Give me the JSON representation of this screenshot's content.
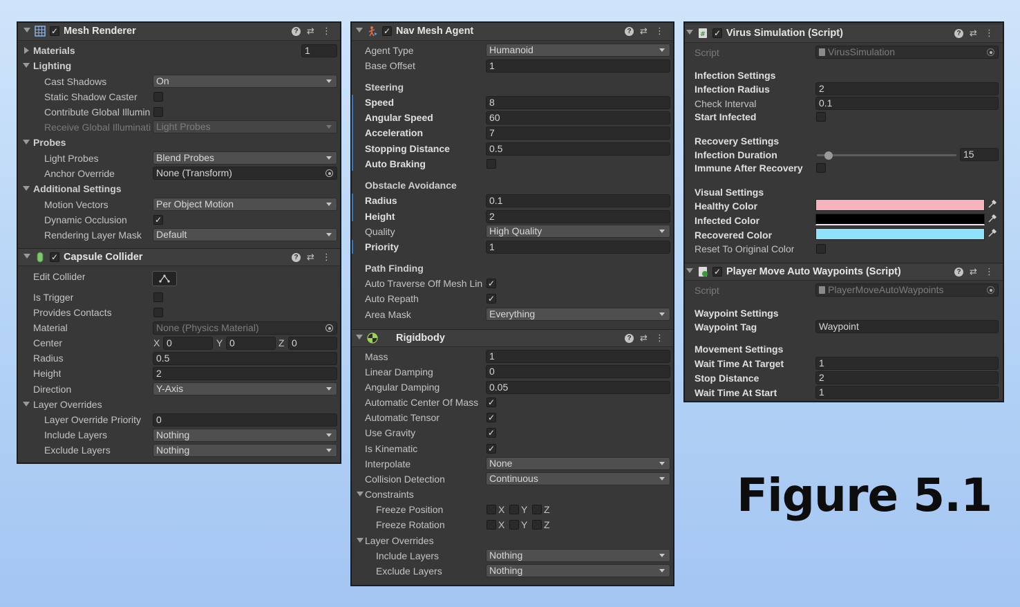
{
  "figure_label": "Figure 5.1",
  "mesh_renderer": {
    "title": "Mesh Renderer",
    "materials_label": "Materials",
    "materials_count": "1",
    "lighting_label": "Lighting",
    "cast_shadows_label": "Cast Shadows",
    "cast_shadows_value": "On",
    "static_shadow_caster_label": "Static Shadow Caster",
    "contribute_gi_label": "Contribute Global Illumin",
    "receive_gi_label": "Receive Global Illuminati",
    "receive_gi_value": "Light Probes",
    "probes_label": "Probes",
    "light_probes_label": "Light Probes",
    "light_probes_value": "Blend Probes",
    "anchor_override_label": "Anchor Override",
    "anchor_override_value": "None (Transform)",
    "additional_label": "Additional Settings",
    "motion_vectors_label": "Motion Vectors",
    "motion_vectors_value": "Per Object Motion",
    "dynamic_occlusion_label": "Dynamic Occlusion",
    "rendering_layer_label": "Rendering Layer Mask",
    "rendering_layer_value": "Default"
  },
  "capsule_collider": {
    "title": "Capsule Collider",
    "edit_collider_label": "Edit Collider",
    "is_trigger_label": "Is Trigger",
    "provides_contacts_label": "Provides Contacts",
    "material_label": "Material",
    "material_value": "None (Physics Material)",
    "center_label": "Center",
    "x_label": "X",
    "y_label": "Y",
    "z_label": "Z",
    "center_x": "0",
    "center_y": "0",
    "center_z": "0",
    "radius_label": "Radius",
    "radius_value": "0.5",
    "height_label": "Height",
    "height_value": "2",
    "direction_label": "Direction",
    "direction_value": "Y-Axis",
    "layer_overrides_label": "Layer Overrides",
    "layer_priority_label": "Layer Override Priority",
    "layer_priority_value": "0",
    "include_layers_label": "Include Layers",
    "include_layers_value": "Nothing",
    "exclude_layers_label": "Exclude Layers",
    "exclude_layers_value": "Nothing"
  },
  "nav_mesh_agent": {
    "title": "Nav Mesh Agent",
    "agent_type_label": "Agent Type",
    "agent_type_value": "Humanoid",
    "base_offset_label": "Base Offset",
    "base_offset_value": "1",
    "steering_label": "Steering",
    "speed_label": "Speed",
    "speed_value": "8",
    "angular_speed_label": "Angular Speed",
    "angular_speed_value": "60",
    "acceleration_label": "Acceleration",
    "acceleration_value": "7",
    "stopping_distance_label": "Stopping Distance",
    "stopping_distance_value": "0.5",
    "auto_braking_label": "Auto Braking",
    "obstacle_label": "Obstacle Avoidance",
    "radius_label": "Radius",
    "radius_value": "0.1",
    "height_label": "Height",
    "height_value": "2",
    "quality_label": "Quality",
    "quality_value": "High Quality",
    "priority_label": "Priority",
    "priority_value": "1",
    "path_label": "Path Finding",
    "auto_traverse_label": "Auto Traverse Off Mesh Lin",
    "auto_repath_label": "Auto Repath",
    "area_mask_label": "Area Mask",
    "area_mask_value": "Everything"
  },
  "rigidbody": {
    "title": "Rigidbody",
    "mass_label": "Mass",
    "mass_value": "1",
    "linear_damping_label": "Linear Damping",
    "linear_damping_value": "0",
    "angular_damping_label": "Angular Damping",
    "angular_damping_value": "0.05",
    "auto_center_label": "Automatic Center Of Mass",
    "auto_tensor_label": "Automatic Tensor",
    "use_gravity_label": "Use Gravity",
    "is_kinematic_label": "Is Kinematic",
    "interpolate_label": "Interpolate",
    "interpolate_value": "None",
    "collision_label": "Collision Detection",
    "collision_value": "Continuous",
    "constraints_label": "Constraints",
    "freeze_position_label": "Freeze Position",
    "freeze_rotation_label": "Freeze Rotation",
    "x_label": "X",
    "y_label": "Y",
    "z_label": "Z",
    "layer_overrides_label": "Layer Overrides",
    "include_layers_label": "Include Layers",
    "include_layers_value": "Nothing",
    "exclude_layers_label": "Exclude Layers",
    "exclude_layers_value": "Nothing"
  },
  "virus_simulation": {
    "title": "Virus Simulation (Script)",
    "script_label": "Script",
    "script_value": "VirusSimulation",
    "infection_settings_label": "Infection Settings",
    "infection_radius_label": "Infection Radius",
    "infection_radius_value": "2",
    "check_interval_label": "Check Interval",
    "check_interval_value": "0.1",
    "start_infected_label": "Start Infected",
    "recovery_settings_label": "Recovery Settings",
    "infection_duration_label": "Infection Duration",
    "infection_duration_value": "15",
    "immune_label": "Immune After Recovery",
    "visual_settings_label": "Visual Settings",
    "healthy_color_label": "Healthy Color",
    "infected_color_label": "Infected Color",
    "recovered_color_label": "Recovered Color",
    "reset_color_label": "Reset To Original Color",
    "colors": {
      "healthy": "#f7b3bd",
      "infected": "#000000",
      "recovered": "#8fe2f7"
    }
  },
  "player_move": {
    "title": "Player Move Auto Waypoints (Script)",
    "script_label": "Script",
    "script_value": "PlayerMoveAutoWaypoints",
    "waypoint_settings_label": "Waypoint Settings",
    "waypoint_tag_label": "Waypoint Tag",
    "waypoint_tag_value": "Waypoint",
    "movement_settings_label": "Movement Settings",
    "wait_target_label": "Wait Time At Target",
    "wait_target_value": "1",
    "stop_distance_label": "Stop Distance",
    "stop_distance_value": "2",
    "wait_start_label": "Wait Time At Start",
    "wait_start_value": "1"
  },
  "check_glyph": "✓",
  "header_icons": {
    "help": "?",
    "presets": "⇄",
    "menu": "⋮"
  }
}
